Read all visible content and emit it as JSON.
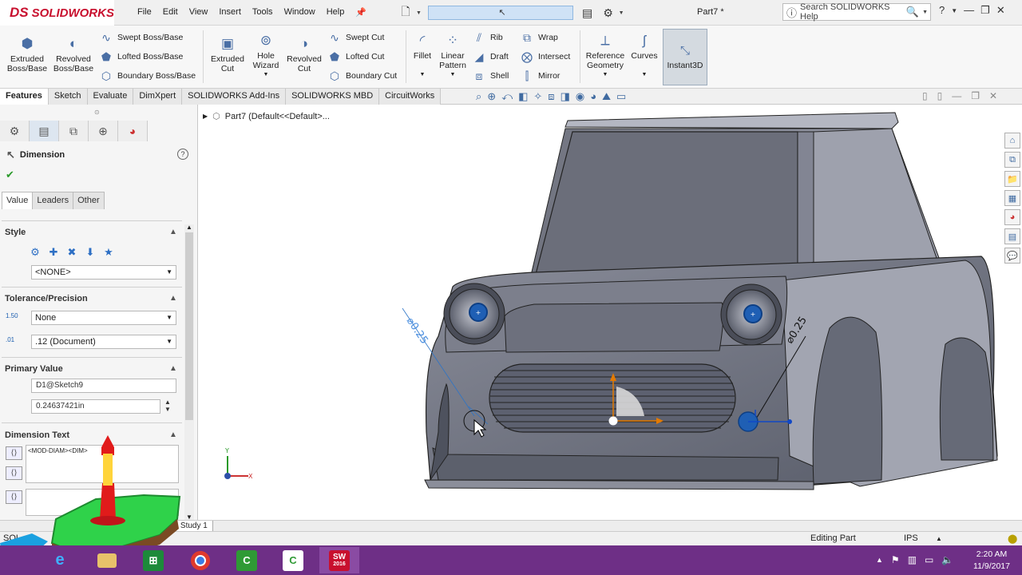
{
  "app": {
    "logo_text": "SOLIDWORKS",
    "logo_prefix": "DS"
  },
  "menu": [
    "File",
    "Edit",
    "View",
    "Insert",
    "Tools",
    "Window",
    "Help"
  ],
  "document_title": "Part7 *",
  "search": {
    "placeholder": "Search SOLIDWORKS Help"
  },
  "ribbon": {
    "extruded_boss": "Extruded Boss/Base",
    "revolved_boss": "Revolved Boss/Base",
    "swept_boss": "Swept Boss/Base",
    "lofted_boss": "Lofted Boss/Base",
    "boundary_boss": "Boundary Boss/Base",
    "extruded_cut": "Extruded Cut",
    "hole_wizard": "Hole Wizard",
    "revolved_cut": "Revolved Cut",
    "swept_cut": "Swept Cut",
    "lofted_cut": "Lofted Cut",
    "boundary_cut": "Boundary Cut",
    "fillet": "Fillet",
    "linear_pattern": "Linear Pattern",
    "rib": "Rib",
    "draft": "Draft",
    "shell": "Shell",
    "wrap": "Wrap",
    "intersect": "Intersect",
    "mirror": "Mirror",
    "reference_geometry": "Reference Geometry",
    "curves": "Curves",
    "instant3d": "Instant3D"
  },
  "tabs": [
    "Features",
    "Sketch",
    "Evaluate",
    "DimXpert",
    "SOLIDWORKS Add-Ins",
    "SOLIDWORKS MBD",
    "CircuitWorks"
  ],
  "feature_tree": {
    "root": "Part7  (Default<<Default>..."
  },
  "property_manager": {
    "title": "Dimension",
    "tabs": [
      "Value",
      "Leaders",
      "Other"
    ],
    "style": {
      "header": "Style",
      "selected": "<NONE>"
    },
    "tolerance": {
      "header": "Tolerance/Precision",
      "tolerance_type": "None",
      "precision": ".12 (Document)",
      "icon1": "1.50",
      "icon2": ".01"
    },
    "primary_value": {
      "header": "Primary Value",
      "reference": "D1@Sketch9",
      "value": "0.24637421in"
    },
    "dimension_text": {
      "header": "Dimension Text",
      "text": "<MOD-DIAM><DIM>"
    }
  },
  "annotations": {
    "dim_left": "⌀0.25",
    "dim_right": "⌀0.25"
  },
  "bottom_tab": "tion Study 1",
  "status": {
    "left": "SOL",
    "editing": "Editing Part",
    "units": "IPS"
  },
  "taskbar": {
    "clock_time": "2:20 AM",
    "clock_date": "11/9/2017",
    "sw_label": "2016"
  }
}
